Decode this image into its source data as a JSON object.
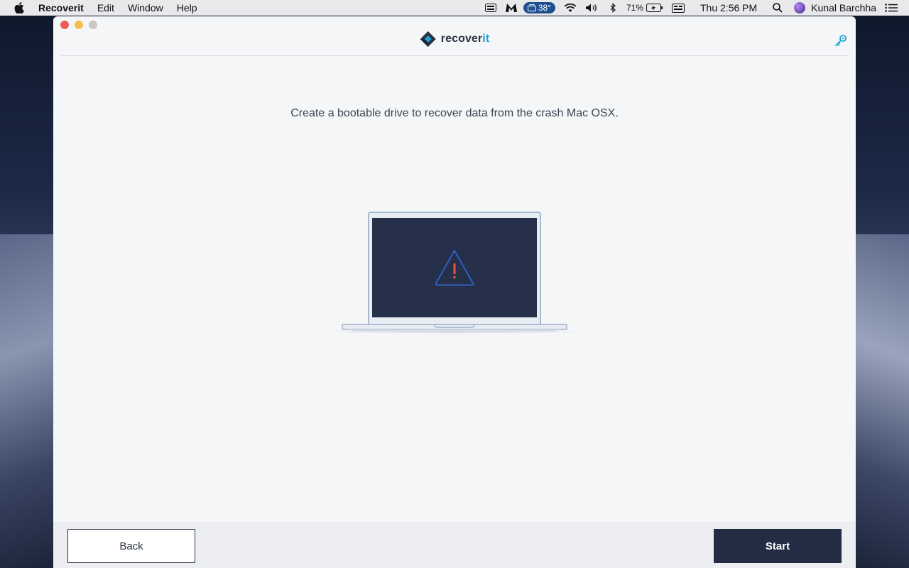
{
  "menubar": {
    "app_name": "Recoverit",
    "items": [
      "Edit",
      "Window",
      "Help"
    ],
    "temperature": "38°",
    "battery": "71%",
    "clock": "Thu 2:56 PM",
    "user": "Kunal Barchha"
  },
  "window": {
    "brand_prefix": "recover",
    "brand_suffix": "it",
    "message": "Create a bootable drive to recover data from the crash Mac OSX.",
    "back_label": "Back",
    "start_label": "Start"
  },
  "colors": {
    "accent": "#17a3d6",
    "primary_button": "#242c44",
    "warning_red": "#e8553d",
    "warning_outline": "#2e5fc0"
  },
  "icons": [
    "apple-icon",
    "key-icon",
    "warning-icon",
    "wifi-icon",
    "volume-icon",
    "battery-icon",
    "search-icon",
    "control-center-icon"
  ]
}
